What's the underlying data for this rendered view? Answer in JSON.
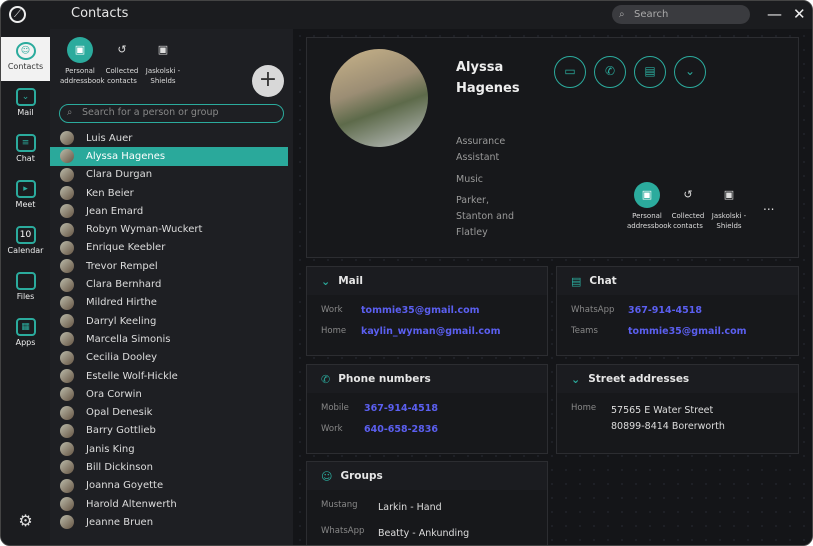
{
  "app": {
    "title": "Contacts",
    "search_placeholder": "Search"
  },
  "rail": [
    {
      "label": "Contacts",
      "icon": "person-icon"
    },
    {
      "label": "Mail",
      "icon": "mail-icon"
    },
    {
      "label": "Chat",
      "icon": "chat-icon"
    },
    {
      "label": "Meet",
      "icon": "video-icon"
    },
    {
      "label": "Calendar",
      "icon": "calendar-icon",
      "day": "10"
    },
    {
      "label": "Files",
      "icon": "folder-icon"
    },
    {
      "label": "Apps",
      "icon": "apps-icon"
    }
  ],
  "books": [
    {
      "label": "Personal addressbook"
    },
    {
      "label": "Collected contacts"
    },
    {
      "label": "Jaskolski - Shields"
    }
  ],
  "list": {
    "search_placeholder": "Search for a person or group",
    "contacts": [
      "Luis Auer",
      "Alyssa Hagenes",
      "Clara Durgan",
      "Ken Beier",
      "Jean Emard",
      "Robyn Wyman-Wuckert",
      "Enrique Keebler",
      "Trevor Rempel",
      "Clara Bernhard",
      "Mildred Hirthe",
      "Darryl Keeling",
      "Marcella Simonis",
      "Cecilia Dooley",
      "Estelle Wolf-Hickle",
      "Ora Corwin",
      "Opal Denesik",
      "Barry Gottlieb",
      "Janis King",
      "Bill Dickinson",
      "Joanna Goyette",
      "Harold Altenwerth",
      "Jeanne Bruen"
    ],
    "selected": "Alyssa Hagenes"
  },
  "profile": {
    "name": "Alyssa Hagenes",
    "title": "Assurance Assistant",
    "department": "Music",
    "company": "Parker, Stanton and Flatley",
    "more": "..."
  },
  "mail": {
    "title": "Mail",
    "rows": [
      {
        "k": "Work",
        "v": "tommie35@gmail.com"
      },
      {
        "k": "Home",
        "v": "kaylin_wyman@gmail.com"
      }
    ]
  },
  "chat": {
    "title": "Chat",
    "rows": [
      {
        "k": "WhatsApp",
        "v": "367-914-4518"
      },
      {
        "k": "Teams",
        "v": "tommie35@gmail.com"
      }
    ]
  },
  "phone": {
    "title": "Phone numbers",
    "rows": [
      {
        "k": "Mobile",
        "v": "367-914-4518"
      },
      {
        "k": "Work",
        "v": "640-658-2836"
      }
    ]
  },
  "address": {
    "title": "Street addresses",
    "k": "Home",
    "line1": "57565 E Water Street",
    "line2": "80899-8414 Borerworth"
  },
  "groups": {
    "title": "Groups",
    "rows": [
      {
        "k": "Mustang",
        "v": "Larkin - Hand"
      },
      {
        "k": "WhatsApp",
        "v": "Beatty - Ankunding"
      }
    ]
  },
  "colors": {
    "accent": "#2bab9d",
    "link": "#5b5ff0"
  }
}
